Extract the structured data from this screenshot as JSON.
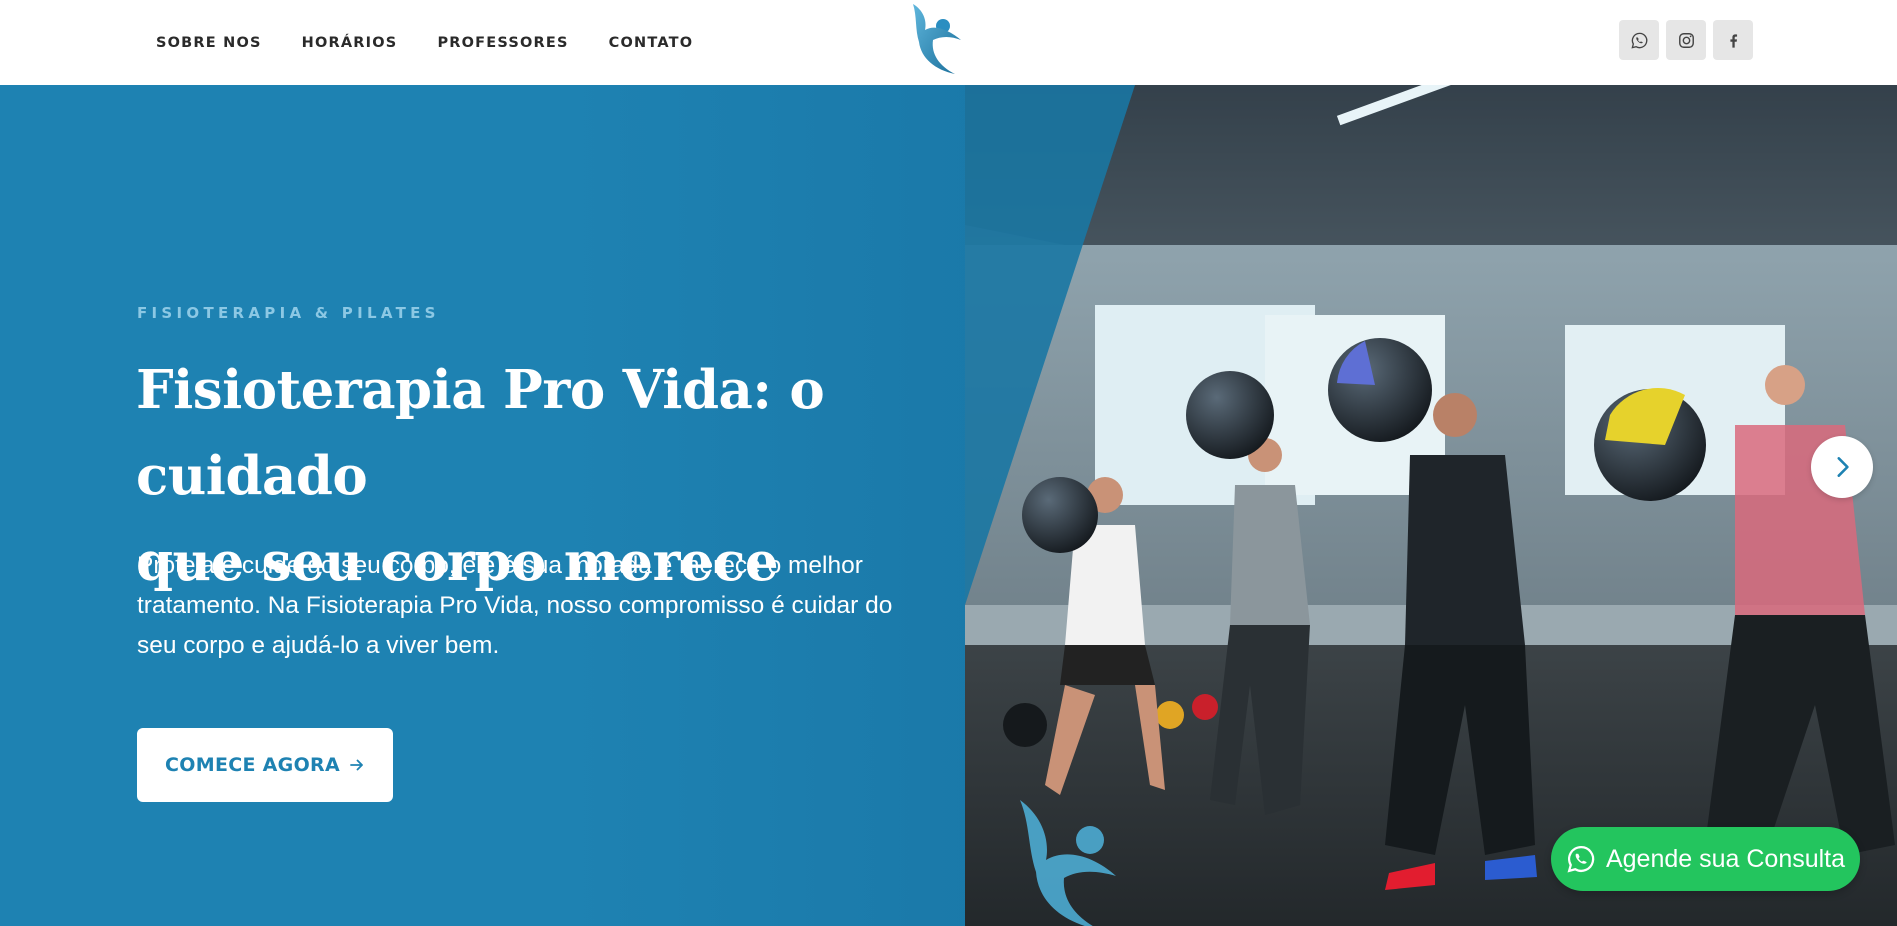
{
  "header": {
    "nav": [
      "SOBRE NOS",
      "HORÁRIOS",
      "PROFESSORES",
      "CONTATO"
    ],
    "logo_icon": "dancer-figure-logo",
    "social_icons": [
      "whatsapp-icon",
      "instagram-icon",
      "facebook-icon"
    ]
  },
  "hero": {
    "eyebrow": "FISIOTERAPIA & PILATES",
    "title_line1": "Fisioterapia Pro Vida: o cuidado",
    "title_line2": "que seu corpo merece",
    "description": "Proteja e cuide do seu corpo, ele é sua morada e merece o melhor tratamento. Na Fisioterapia Pro Vida, nosso compromisso é cuidar do seu corpo e ajudá-lo a viver bem.",
    "cta_label": "COMECE AGORA",
    "image_alt": "group-medicine-ball-squat-photo"
  },
  "floating_button": {
    "label": "Agende sua Consulta"
  },
  "colors": {
    "primary": "#1e82b2",
    "whatsapp": "#23c55e",
    "nav_text": "#2a2a2a"
  }
}
